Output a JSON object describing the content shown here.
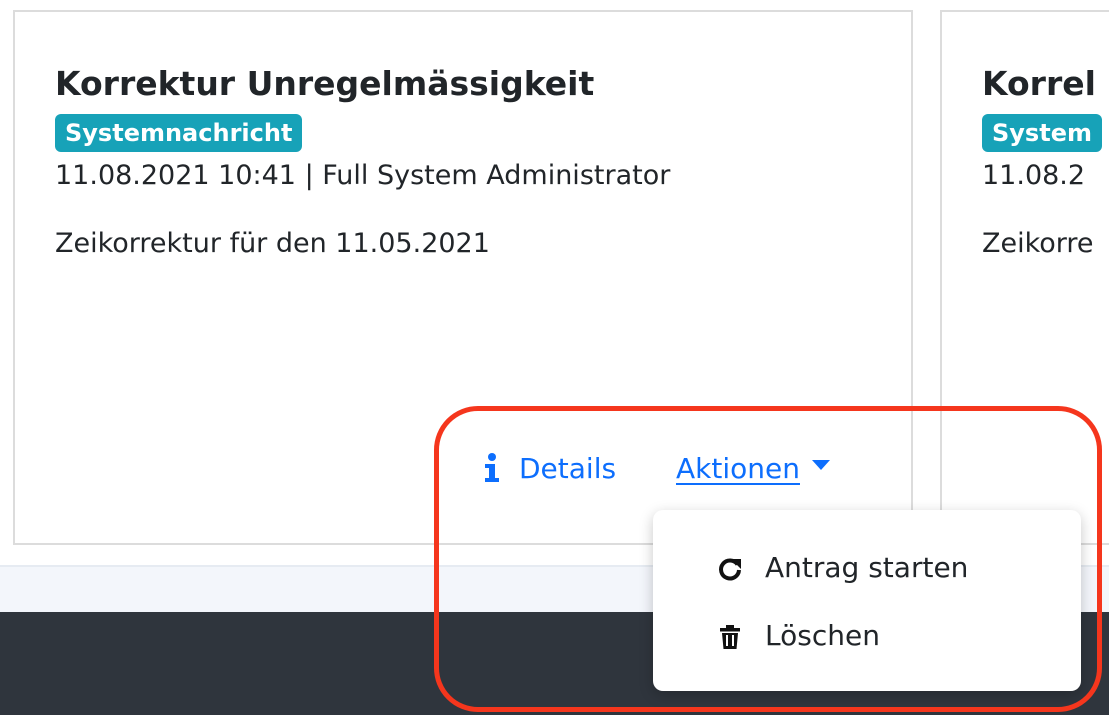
{
  "cards": [
    {
      "title": "Korrektur Unregelmässigkeit",
      "badge": "Systemnachricht",
      "meta": "11.08.2021 10:41 | Full System Administrator",
      "text": "Zeikorrektur für den 11.05.2021"
    },
    {
      "title": "Korrel",
      "badge": "System",
      "meta": "11.08.2",
      "text": "Zeikorre"
    }
  ],
  "links": {
    "details_label": "Details",
    "details_icon": "info-icon",
    "actions_label": "Aktionen",
    "actions_icon": "caret-down-icon"
  },
  "dropdown": {
    "items": [
      {
        "label": "Antrag starten",
        "icon": "redo-icon"
      },
      {
        "label": "Löschen",
        "icon": "trash-icon"
      }
    ]
  },
  "colors": {
    "link": "#0d6efd",
    "badge": "#17a2b8",
    "highlight": "#f5361d",
    "footer": "#2f353d",
    "strip": "#f3f6fb"
  }
}
